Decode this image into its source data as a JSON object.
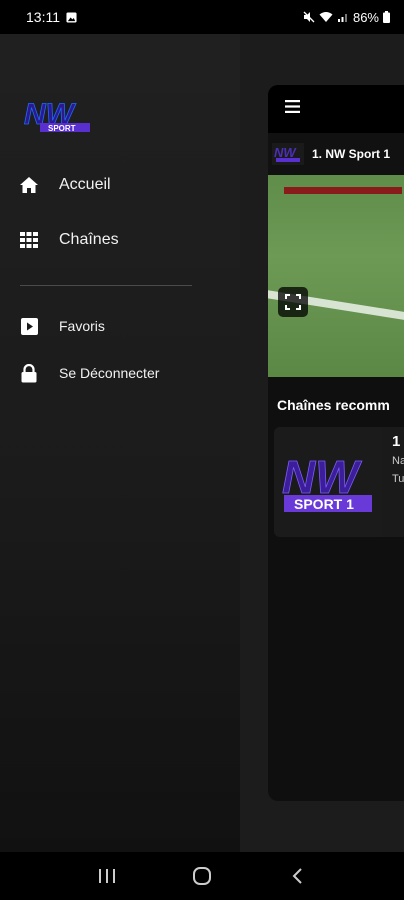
{
  "status_bar": {
    "time": "13:11",
    "battery": "86%"
  },
  "drawer": {
    "logo_text": "NW",
    "logo_sub": "SPORT",
    "items": [
      {
        "label": "Accueil",
        "icon": "home-icon"
      },
      {
        "label": "Chaînes",
        "icon": "grid-icon"
      },
      {
        "label": "Favoris",
        "icon": "play-square-icon"
      },
      {
        "label": "Se Déconnecter",
        "icon": "lock-icon"
      }
    ]
  },
  "main": {
    "current_channel": "1. NW Sport 1",
    "section_title": "Chaînes recomm",
    "card": {
      "number": "1",
      "line1": "Na",
      "line2": "Tu",
      "logo_text": "NW",
      "logo_sub": "SPORT 1"
    }
  },
  "colors": {
    "accent_purple": "#3a1a9c",
    "drawer_bg": "#1e1e1e"
  }
}
